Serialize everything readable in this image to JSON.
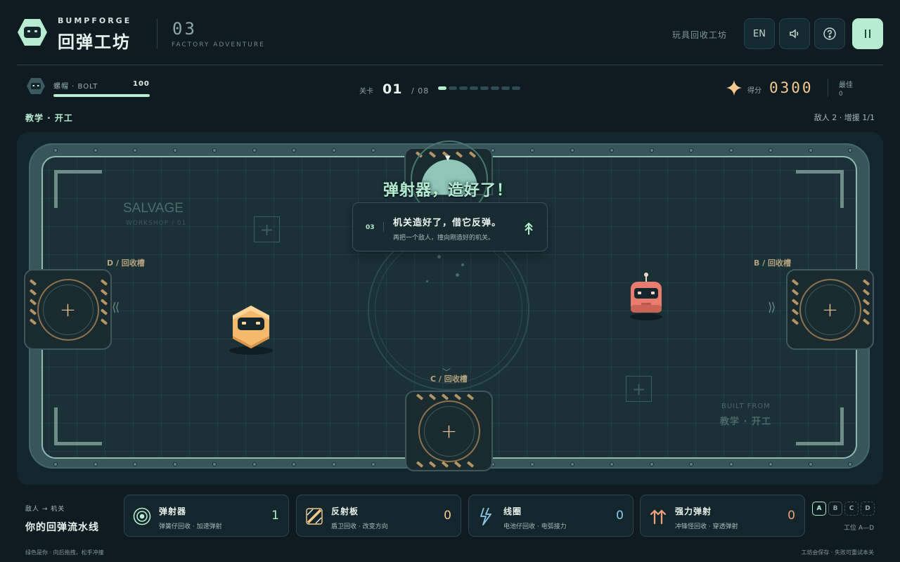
{
  "header": {
    "brand_en": "BUMPFORGE",
    "brand_zh": "回弹工坊",
    "level_number": "03",
    "level_subtitle": "FACTORY ADVENTURE",
    "right_label": "玩具回收工坊",
    "lang_button": "EN",
    "icons": [
      "sound-icon",
      "help-icon",
      "pause-icon"
    ]
  },
  "status": {
    "player_label": "螺帽 · BOLT",
    "player_hp": "100",
    "player_hp_fraction": 1.0,
    "stage_label": "关卡",
    "stage_current": "01",
    "stage_total": "/ 08",
    "stage_progress": {
      "current": 1,
      "total": 8
    },
    "score_label": "得分",
    "score_value": "0300",
    "best_label": "最佳",
    "best_value": "0",
    "mode_label": "教学 · 开工",
    "enemy_info": "敌人 2 · 增援 1/1"
  },
  "arena": {
    "watermark_title": "SALVAGE",
    "watermark_sub": "WORKSHOP / 01",
    "built_from_label": "BUILT FROM",
    "built_from_value": "教学 · 开工",
    "slot_labels": {
      "d": "D / 回收槽",
      "b": "B / 回收槽",
      "c": "C / 回收槽"
    },
    "banner_title": "弹射器，造好了！",
    "tip": {
      "number": "03",
      "headline": "机关造好了，借它反弹。",
      "detail": "再把一个敌人，撞向刚造好的机关。"
    }
  },
  "bottom": {
    "chain_label": "敌人 → 机关",
    "chain_title": "你的回弹流水线",
    "cards": [
      {
        "name": "弹射器",
        "desc": "弹簧仔回收 · 加速弹射",
        "count": "1",
        "color": "#b7ecd0",
        "icon": "launcher-icon"
      },
      {
        "name": "反射板",
        "desc": "盾卫回收 · 改变方向",
        "count": "0",
        "color": "#f7c98f",
        "icon": "reflector-icon"
      },
      {
        "name": "线圈",
        "desc": "电池仔回收 · 电弧接力",
        "count": "0",
        "color": "#8cc8ec",
        "icon": "coil-icon"
      },
      {
        "name": "强力弹射",
        "desc": "冲锋怪回收 · 穿透弹射",
        "count": "0",
        "color": "#f2a07e",
        "icon": "power-launch-icon"
      }
    ],
    "slot_keys": [
      "A",
      "B",
      "C",
      "D"
    ],
    "slot_keys_label": "工位 A—D",
    "footer_left": "绿色是你 · 向后拖拽，松手冲撞",
    "footer_right": "工坊会保存 · 失败可重试本关"
  }
}
